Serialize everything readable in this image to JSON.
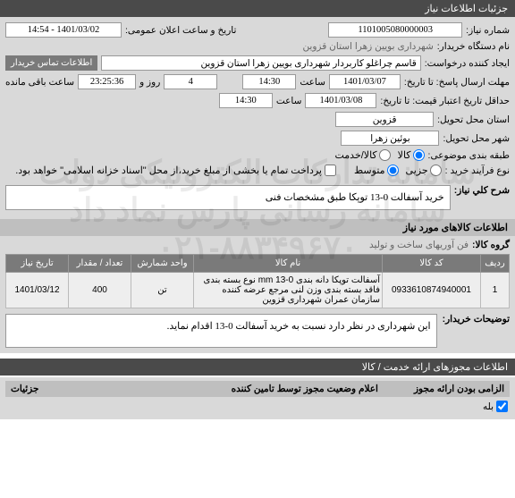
{
  "header1": "جزئیات اطلاعات نیاز",
  "fields": {
    "need_no_label": "شماره نیاز:",
    "need_no": "1101005080000003",
    "pub_label": "تاریخ و ساعت اعلان عمومی:",
    "pub_value": "1401/03/02 - 14:54",
    "buyer_org_label": "نام دستگاه خریدار:",
    "buyer_org": "شهرداری بویین زهرا استان قزوین",
    "requester_label": "ایجاد کننده درخواست:",
    "requester": "قاسم چراغلو کاربردار شهرداری بویین زهرا استان قزوین",
    "contact_btn": "اطلاعات تماس خریدار",
    "deadline_label": "مهلت ارسال پاسخ: تا تاریخ:",
    "deadline_date": "1401/03/07",
    "time_label": "ساعت",
    "deadline_time": "14:30",
    "remaining_label": "ساعت باقی مانده",
    "remaining_day": "4",
    "day_label": "روز و",
    "remaining_time": "23:25:36",
    "min_validity_label": "حداقل تاریخ اعتبار قیمت: تا تاریخ:",
    "min_validity_date": "1401/03/08",
    "min_validity_time": "14:30",
    "province_label": "استان محل تحویل:",
    "province": "قزوین",
    "city_label": "شهر محل تحویل:",
    "city": "بوئین زهرا",
    "category_label": "طبقه بندی موضوعی:",
    "cat_goods": "کالا",
    "cat_service": "کالا/خدمت",
    "purchase_type_label": "نوع فرآیند خرید :",
    "pt_small": "جزیی",
    "pt_medium": "متوسط",
    "payment_text": "پرداخت تمام یا بخشی از مبلغ خرید،از محل \"اسناد خزانه اسلامی\" خواهد بود.",
    "general_desc_label": "شرح کلي نياز:",
    "general_desc": "خرید آسفالت 0-13 توپکا طبق مشخصات فنی"
  },
  "items_section": {
    "title": "اطلاعات کالاهای مورد نیاز",
    "group_label": "گروه کالا:",
    "group_value": "فن آوریهای ساخت و تولید",
    "columns": {
      "row": "ردیف",
      "code": "کد کالا",
      "name": "نام کالا",
      "unit": "واحد شمارش",
      "qty": "تعداد / مقدار",
      "date": "تاریخ نیاز"
    },
    "rows": [
      {
        "row": "1",
        "code": "0933610874940001",
        "name": "آسفالت توپکا دانه بندی 0-13 mm نوع بسته بندی فاقد بسته بندی وزن لنی مرجع عرضه کننده سازمان عمران شهرداری قزوین",
        "unit": "تن",
        "qty": "400",
        "date": "1401/03/12"
      }
    ],
    "explain_label": "توضیحات خریدار:",
    "explain_text": "این شهرداری در نظر دارد نسبت به خرید آسفالت 0-13 اقدام نماید."
  },
  "footer": {
    "title": "اطلاعات مجوزهای ارائه خدمت / کالا",
    "col1": "الزامی بودن ارائه مجوز",
    "col2": "اعلام وضعیت مجوز توسط تامین کننده",
    "col3": "جزئیات",
    "mandatory_value": "بله"
  },
  "watermark": {
    "line1": "سامانه تدارکات الکترونیکی دولت",
    "line2": "سامانه رسانی پارس نماد داد",
    "line3": "۰۲۱-۸۸۳۴۹۶۷۰"
  }
}
